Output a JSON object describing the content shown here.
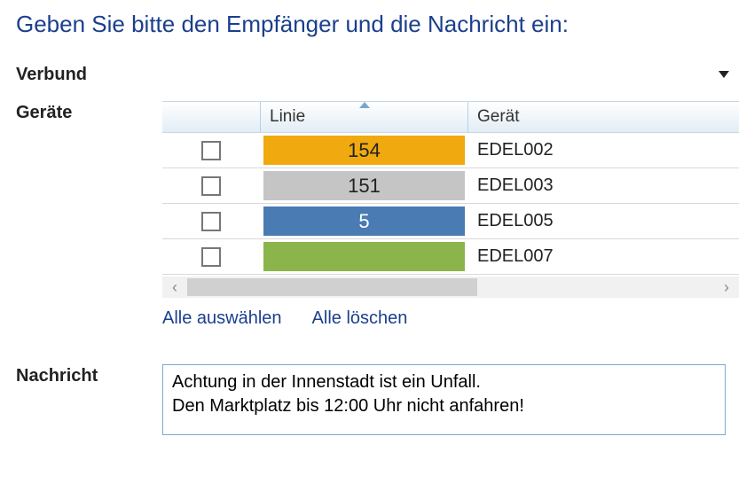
{
  "title": "Geben Sie bitte den Empfänger und die Nachricht ein:",
  "labels": {
    "verbund": "Verbund",
    "geraete": "Geräte",
    "nachricht": "Nachricht"
  },
  "table": {
    "headers": {
      "linie": "Linie",
      "geraet": "Gerät"
    },
    "rows": [
      {
        "checked": false,
        "linie": "154",
        "linie_bg": "#f0a90e",
        "linie_fg": "#222222",
        "geraet": "EDEL002"
      },
      {
        "checked": false,
        "linie": "151",
        "linie_bg": "#c5c5c5",
        "linie_fg": "#222222",
        "geraet": "EDEL003"
      },
      {
        "checked": false,
        "linie": "5",
        "linie_bg": "#4a7bb2",
        "linie_fg": "#ffffff",
        "geraet": "EDEL005"
      },
      {
        "checked": false,
        "linie": "",
        "linie_bg": "#8bb54a",
        "linie_fg": "#222222",
        "geraet": "EDEL007"
      }
    ]
  },
  "links": {
    "select_all": "Alle auswählen",
    "clear_all": "Alle löschen"
  },
  "message": "Achtung in der Innenstadt ist ein Unfall.\nDen Marktplatz bis 12:00 Uhr nicht anfahren!"
}
